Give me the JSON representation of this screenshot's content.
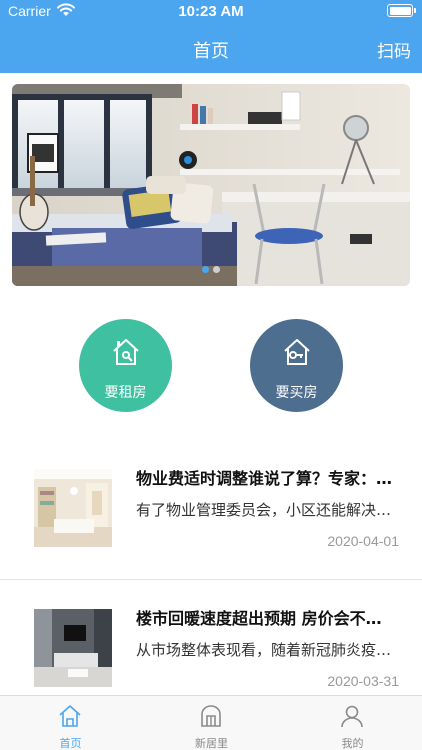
{
  "status_bar": {
    "carrier": "Carrier",
    "time": "10:23 AM"
  },
  "header": {
    "title": "首页",
    "scan_label": "扫码"
  },
  "banner": {
    "slide_count": 2,
    "active_index": 0
  },
  "actions": [
    {
      "label": "要租房",
      "icon": "house-key-icon",
      "color": "#3fc0a0"
    },
    {
      "label": "要买房",
      "icon": "house-key-icon",
      "color": "#4d6e8f"
    }
  ],
  "news": [
    {
      "title": "物业费适时调整谁说了算？专家：需要满足...",
      "summary": "有了物业管理委员会，小区还能解决哪些问题",
      "date": "2020-04-01"
    },
    {
      "title": "楼市回暖速度超出预期 房价会不会上涨",
      "summary": "从市场整体表现看，随着新冠肺炎疫情逐步好转",
      "date": "2020-03-31"
    }
  ],
  "tabbar": {
    "tabs": [
      {
        "label": "首页",
        "icon": "home-icon",
        "active": true
      },
      {
        "label": "新居里",
        "icon": "door-icon",
        "active": false
      },
      {
        "label": "我的",
        "icon": "person-icon",
        "active": false
      }
    ]
  },
  "colors": {
    "primary": "#4ba6ef",
    "rent": "#3fc0a0",
    "buy": "#4d6e8f",
    "date": "#9a9a9a"
  }
}
